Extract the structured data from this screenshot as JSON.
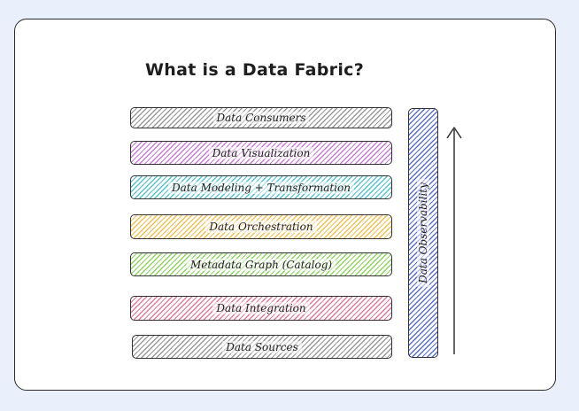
{
  "title": "What is a Data Fabric?",
  "layers": [
    {
      "label": "Data Consumers",
      "color": "#9a9a9a"
    },
    {
      "label": "Data Visualization",
      "color": "#c77dd6"
    },
    {
      "label": "Data Modeling + Transformation",
      "color": "#56c3cf"
    },
    {
      "label": "Data Orchestration",
      "color": "#f0c050"
    },
    {
      "label": "Metadata Graph (Catalog)",
      "color": "#8fd462"
    },
    {
      "label": "Data Integration",
      "color": "#e57a9a"
    },
    {
      "label": "Data Sources",
      "color": "#9a9a9a"
    }
  ],
  "side_bar": {
    "label": "Data Observability",
    "color": "#5b6fd6"
  },
  "arrow": {
    "direction": "up"
  }
}
